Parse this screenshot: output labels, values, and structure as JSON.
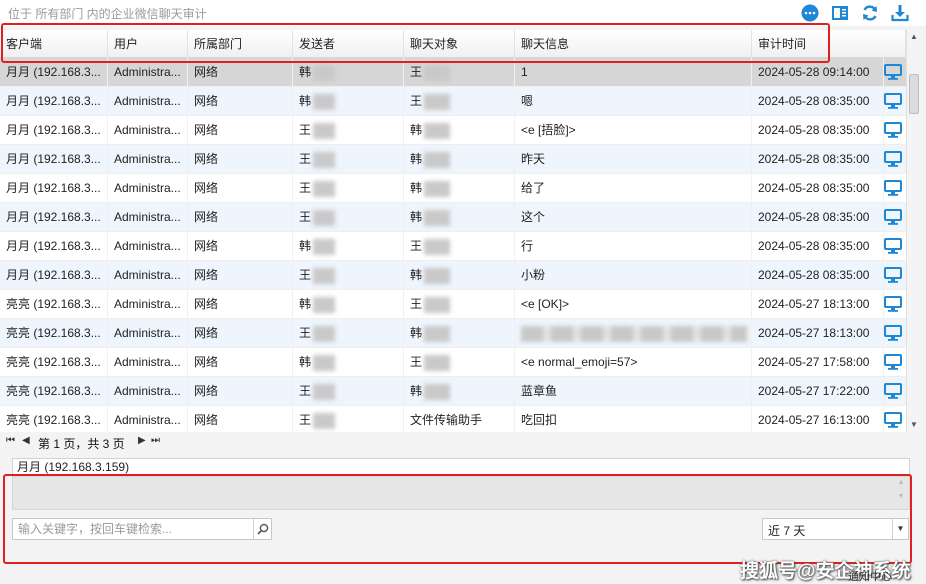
{
  "header": {
    "breadcrumb": "位于 所有部门 内的企业微信聊天审计"
  },
  "toolbar": [
    {
      "icon": "chat-bubble-icon",
      "color": "#1e88d6"
    },
    {
      "icon": "panel-layout-icon",
      "color": "#1e88d6"
    },
    {
      "icon": "refresh-icon",
      "color": "#1e88d6"
    },
    {
      "icon": "download-icon",
      "color": "#1e88d6"
    }
  ],
  "table": {
    "columns": [
      "客户端",
      "用户",
      "所属部门",
      "发送者",
      "聊天对象",
      "聊天信息",
      "审计时间"
    ],
    "rows": [
      {
        "client": "月月 (192.168.3...",
        "user": "Administra...",
        "dept": "网络",
        "sender": "韩",
        "target": "王",
        "message": "1",
        "time": "2024-05-28 09:14:00"
      },
      {
        "client": "月月 (192.168.3...",
        "user": "Administra...",
        "dept": "网络",
        "sender": "韩",
        "target": "王",
        "message": "嗯",
        "time": "2024-05-28 08:35:00"
      },
      {
        "client": "月月 (192.168.3...",
        "user": "Administra...",
        "dept": "网络",
        "sender": "王",
        "target": "韩",
        "message": "<e [捂脸]>",
        "time": "2024-05-28 08:35:00"
      },
      {
        "client": "月月 (192.168.3...",
        "user": "Administra...",
        "dept": "网络",
        "sender": "王",
        "target": "韩",
        "message": "昨天",
        "time": "2024-05-28 08:35:00"
      },
      {
        "client": "月月 (192.168.3...",
        "user": "Administra...",
        "dept": "网络",
        "sender": "王",
        "target": "韩",
        "message": "给了",
        "time": "2024-05-28 08:35:00"
      },
      {
        "client": "月月 (192.168.3...",
        "user": "Administra...",
        "dept": "网络",
        "sender": "王",
        "target": "韩",
        "message": "这个",
        "time": "2024-05-28 08:35:00"
      },
      {
        "client": "月月 (192.168.3...",
        "user": "Administra...",
        "dept": "网络",
        "sender": "韩",
        "target": "王",
        "message": "行",
        "time": "2024-05-28 08:35:00"
      },
      {
        "client": "月月 (192.168.3...",
        "user": "Administra...",
        "dept": "网络",
        "sender": "王",
        "target": "韩",
        "message": "小粉",
        "time": "2024-05-28 08:35:00"
      },
      {
        "client": "亮亮 (192.168.3...",
        "user": "Administra...",
        "dept": "网络",
        "sender": "韩",
        "target": "王",
        "message": "<e [OK]>",
        "time": "2024-05-27 18:13:00"
      },
      {
        "client": "亮亮 (192.168.3...",
        "user": "Administra...",
        "dept": "网络",
        "sender": "王",
        "target": "韩",
        "message": "",
        "time": "2024-05-27 18:13:00"
      },
      {
        "client": "亮亮 (192.168.3...",
        "user": "Administra...",
        "dept": "网络",
        "sender": "韩",
        "target": "王",
        "message": "<e normal_emoji=57>",
        "time": "2024-05-27 17:58:00"
      },
      {
        "client": "亮亮 (192.168.3...",
        "user": "Administra...",
        "dept": "网络",
        "sender": "王",
        "target": "韩",
        "message": "蓝章鱼",
        "time": "2024-05-27 17:22:00"
      },
      {
        "client": "亮亮 (192.168.3...",
        "user": "Administra...",
        "dept": "网络",
        "sender": "王",
        "target": "文件传输助手",
        "message": "吃回扣",
        "time": "2024-05-27 16:13:00"
      }
    ]
  },
  "pager": {
    "text": "第 1 页，共 3 页"
  },
  "detail": {
    "title": "月月 (192.168.3.159)"
  },
  "search": {
    "placeholder": "输入关键字，按回车键检索..."
  },
  "range_select": {
    "value": "近 7 天"
  },
  "watermark": "搜狐号@安企神系统",
  "notice": "通知中心",
  "colors": {
    "accent": "#1e88d6",
    "highlight_border": "#e0201c",
    "alt_row": "#eef5fc",
    "selected_row": "#d6d6d6"
  }
}
